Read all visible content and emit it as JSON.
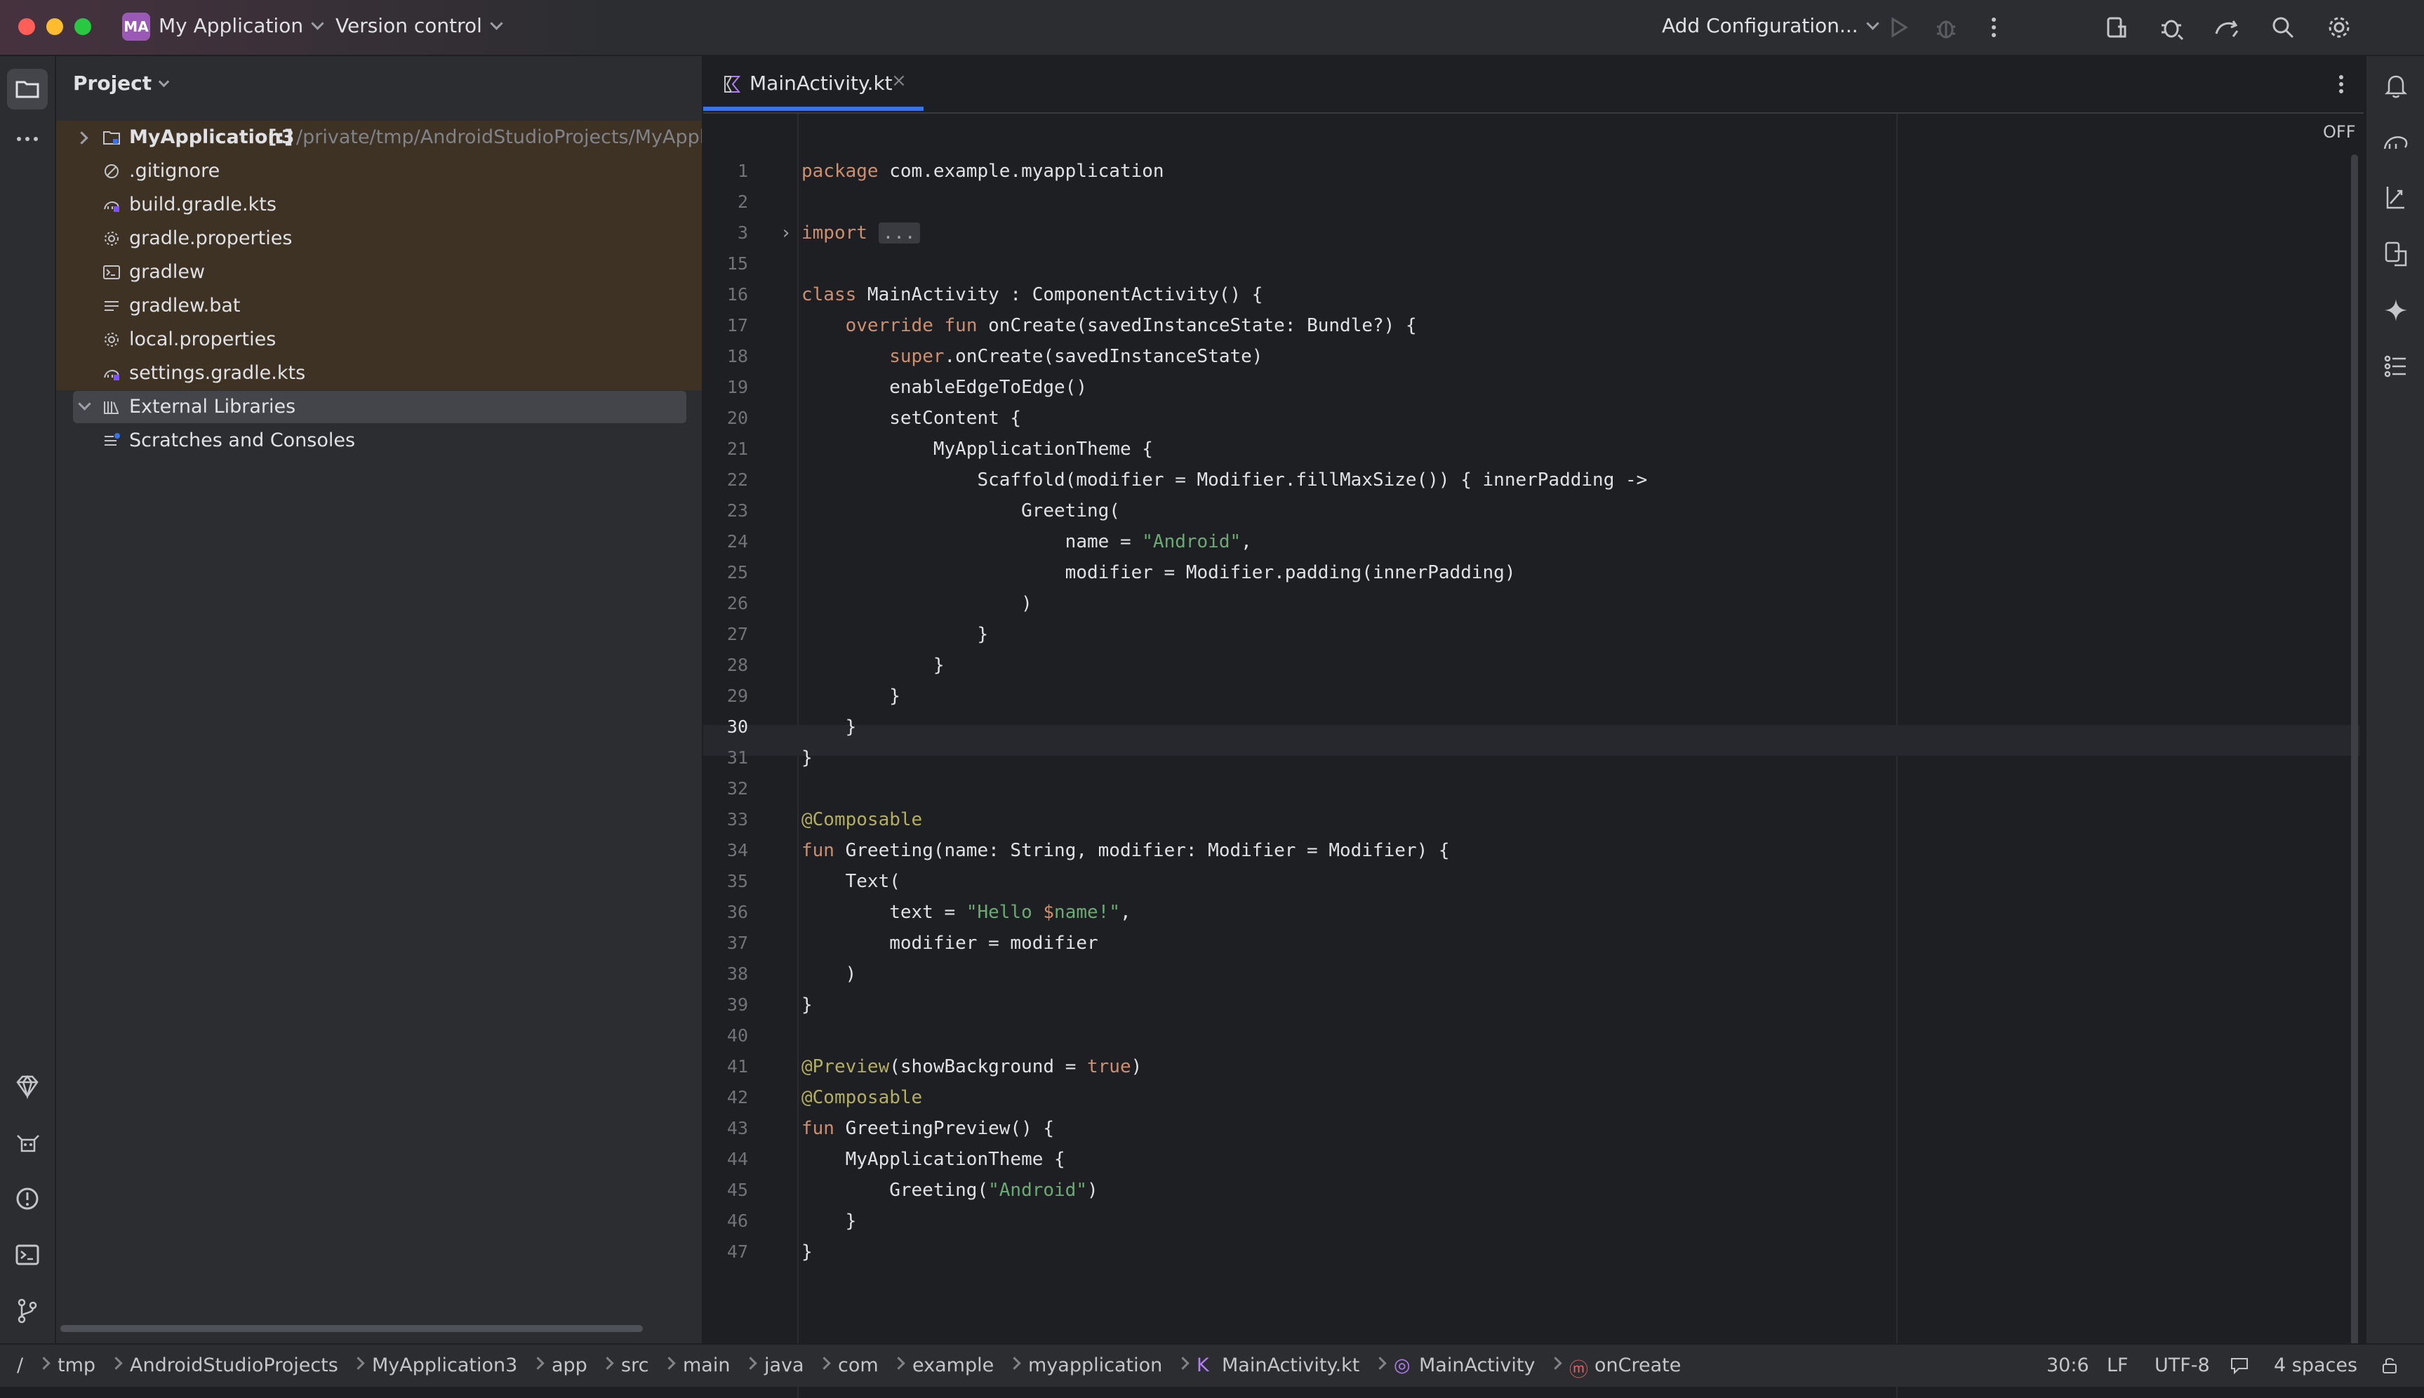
{
  "titlebar": {
    "project_badge": "MA",
    "project_name": "My Application",
    "vcs_label": "Version control",
    "run_config": "Add Configuration..."
  },
  "project_panel": {
    "title": "Project",
    "root": {
      "name": "MyApplication3",
      "marker": "[:]",
      "path": "/private/tmp/AndroidStudioProjects/MyApplicat"
    },
    "files": [
      {
        "name": ".gitignore",
        "icon": "ignore-file-icon"
      },
      {
        "name": "build.gradle.kts",
        "icon": "gradle-icon"
      },
      {
        "name": "gradle.properties",
        "icon": "settings-file-icon"
      },
      {
        "name": "gradlew",
        "icon": "terminal-file-icon"
      },
      {
        "name": "gradlew.bat",
        "icon": "text-file-icon"
      },
      {
        "name": "local.properties",
        "icon": "settings-file-icon"
      },
      {
        "name": "settings.gradle.kts",
        "icon": "gradle-icon"
      }
    ],
    "external_libraries": "External Libraries",
    "scratches": "Scratches and Consoles"
  },
  "editor": {
    "tab_label": "MainActivity.kt",
    "inspection_widget": "OFF",
    "current_line": 30,
    "lines": [
      {
        "n": "1",
        "t": "package com.example.myapplication"
      },
      {
        "n": "2",
        "t": ""
      },
      {
        "n": "3",
        "t": "import ..."
      },
      {
        "n": "15",
        "t": ""
      },
      {
        "n": "16",
        "t": "class MainActivity : ComponentActivity() {"
      },
      {
        "n": "17",
        "t": "    override fun onCreate(savedInstanceState: Bundle?) {"
      },
      {
        "n": "18",
        "t": "        super.onCreate(savedInstanceState)"
      },
      {
        "n": "19",
        "t": "        enableEdgeToEdge()"
      },
      {
        "n": "20",
        "t": "        setContent {"
      },
      {
        "n": "21",
        "t": "            MyApplicationTheme {"
      },
      {
        "n": "22",
        "t": "                Scaffold(modifier = Modifier.fillMaxSize()) { innerPadding ->"
      },
      {
        "n": "23",
        "t": "                    Greeting("
      },
      {
        "n": "24",
        "t": "                        name = \"Android\","
      },
      {
        "n": "25",
        "t": "                        modifier = Modifier.padding(innerPadding)"
      },
      {
        "n": "26",
        "t": "                    )"
      },
      {
        "n": "27",
        "t": "                }"
      },
      {
        "n": "28",
        "t": "            }"
      },
      {
        "n": "29",
        "t": "        }"
      },
      {
        "n": "30",
        "t": "    }"
      },
      {
        "n": "31",
        "t": "}"
      },
      {
        "n": "32",
        "t": ""
      },
      {
        "n": "33",
        "t": "@Composable"
      },
      {
        "n": "34",
        "t": "fun Greeting(name: String, modifier: Modifier = Modifier) {"
      },
      {
        "n": "35",
        "t": "    Text("
      },
      {
        "n": "36",
        "t": "        text = \"Hello $name!\","
      },
      {
        "n": "37",
        "t": "        modifier = modifier"
      },
      {
        "n": "38",
        "t": "    )"
      },
      {
        "n": "39",
        "t": "}"
      },
      {
        "n": "40",
        "t": ""
      },
      {
        "n": "41",
        "t": "@Preview(showBackground = true)"
      },
      {
        "n": "42",
        "t": "@Composable"
      },
      {
        "n": "43",
        "t": "fun GreetingPreview() {"
      },
      {
        "n": "44",
        "t": "    MyApplicationTheme {"
      },
      {
        "n": "45",
        "t": "        Greeting(\"Android\")"
      },
      {
        "n": "46",
        "t": "    }"
      },
      {
        "n": "47",
        "t": "}"
      }
    ]
  },
  "statusbar": {
    "breadcrumbs": [
      "/",
      "tmp",
      "AndroidStudioProjects",
      "MyApplication3",
      "app",
      "src",
      "main",
      "java",
      "com",
      "example",
      "myapplication",
      "MainActivity.kt",
      "MainActivity",
      "onCreate"
    ],
    "position": "30:6",
    "line_ending": "LF",
    "encoding": "UTF-8",
    "indent": "4 spaces"
  },
  "colors": {
    "keyword": "#cf8e6d",
    "string": "#6aab73",
    "annotation": "#b3ae60",
    "accent": "#3574f0",
    "vcs_highlight": "#3d3223"
  }
}
